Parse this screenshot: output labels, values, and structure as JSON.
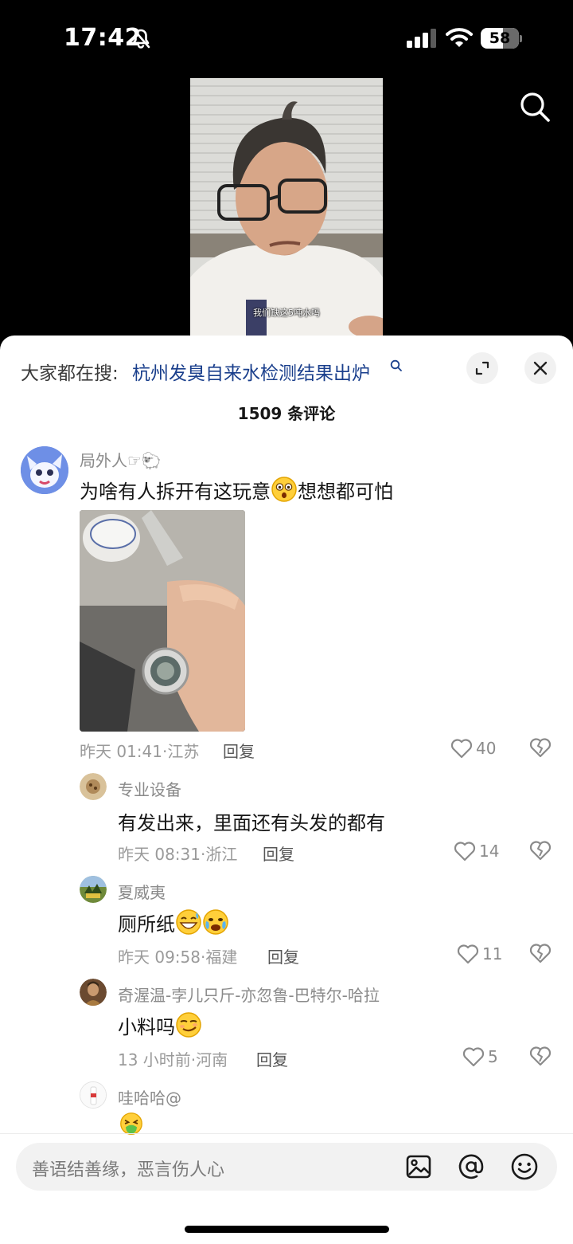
{
  "status": {
    "time": "17:42",
    "battery": "58",
    "battery_level": 0.58
  },
  "video": {
    "caption": "我们缺这5吨水吗"
  },
  "sheet": {
    "trend_prefix": "大家都在搜:",
    "trend_link": "杭州发臭自来水检测结果出炉",
    "comment_count": "1509 条评论"
  },
  "comments": [
    {
      "user": "局外人☞🐑",
      "text_a": "为啥有人拆开有这玩意",
      "text_b": "想想都可怕",
      "meta": "昨天 01:41·江苏",
      "reply": "回复",
      "likes": "40"
    },
    {
      "user": "专业设备",
      "text": "有发出来，里面还有头发的都有",
      "meta": "昨天 08:31·浙江",
      "reply": "回复",
      "likes": "14"
    },
    {
      "user": "夏威夷",
      "text": "厕所纸",
      "meta": "昨天 09:58·福建",
      "reply": "回复",
      "likes": "11"
    },
    {
      "user": "奇渥温-孛儿只斤-亦忽鲁-巴特尔-哈拉",
      "text": "小料吗",
      "meta": "13 小时前·河南",
      "reply": "回复",
      "likes": "5"
    },
    {
      "user": "哇哈哈@"
    }
  ],
  "input": {
    "placeholder": "善语结善缘，恶言伤人心"
  },
  "icons": {
    "mute": "bell-slash-icon",
    "signal": "cellular-signal-icon",
    "wifi": "wifi-icon",
    "search": "magnifier-icon",
    "expand": "expand-icon",
    "close": "close-icon",
    "like": "heart-outline-icon",
    "dislike": "broken-heart-icon",
    "image": "image-icon",
    "mention": "at-icon",
    "emoji": "smiley-icon"
  },
  "colors": {
    "link": "#1a3f8c",
    "text": "#161616",
    "muted": "#8a8a8a"
  }
}
